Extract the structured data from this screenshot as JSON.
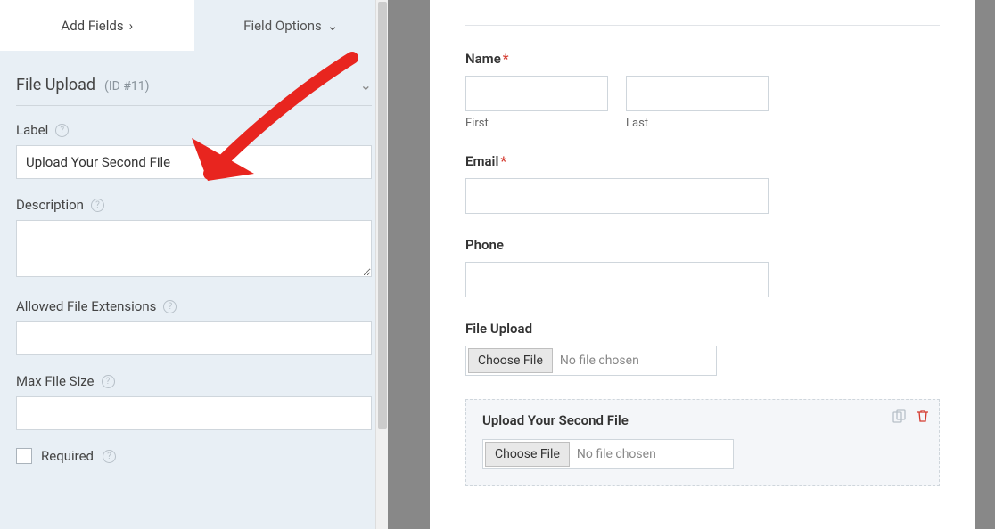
{
  "tabs": {
    "add_fields": "Add Fields",
    "field_options": "Field Options"
  },
  "section": {
    "title": "File Upload",
    "id": "(ID #11)"
  },
  "options": {
    "label_caption": "Label",
    "label_value": "Upload Your Second File",
    "description_caption": "Description",
    "description_value": "",
    "ext_caption": "Allowed File Extensions",
    "ext_value": "",
    "maxsize_caption": "Max File Size",
    "maxsize_value": "",
    "required_caption": "Required"
  },
  "preview": {
    "name_label": "Name",
    "first_sublabel": "First",
    "last_sublabel": "Last",
    "email_label": "Email",
    "phone_label": "Phone",
    "file_upload_label": "File Upload",
    "choose_btn": "Choose File",
    "no_file": "No file chosen",
    "second_upload_label": "Upload Your Second File"
  },
  "required_mark": "*"
}
